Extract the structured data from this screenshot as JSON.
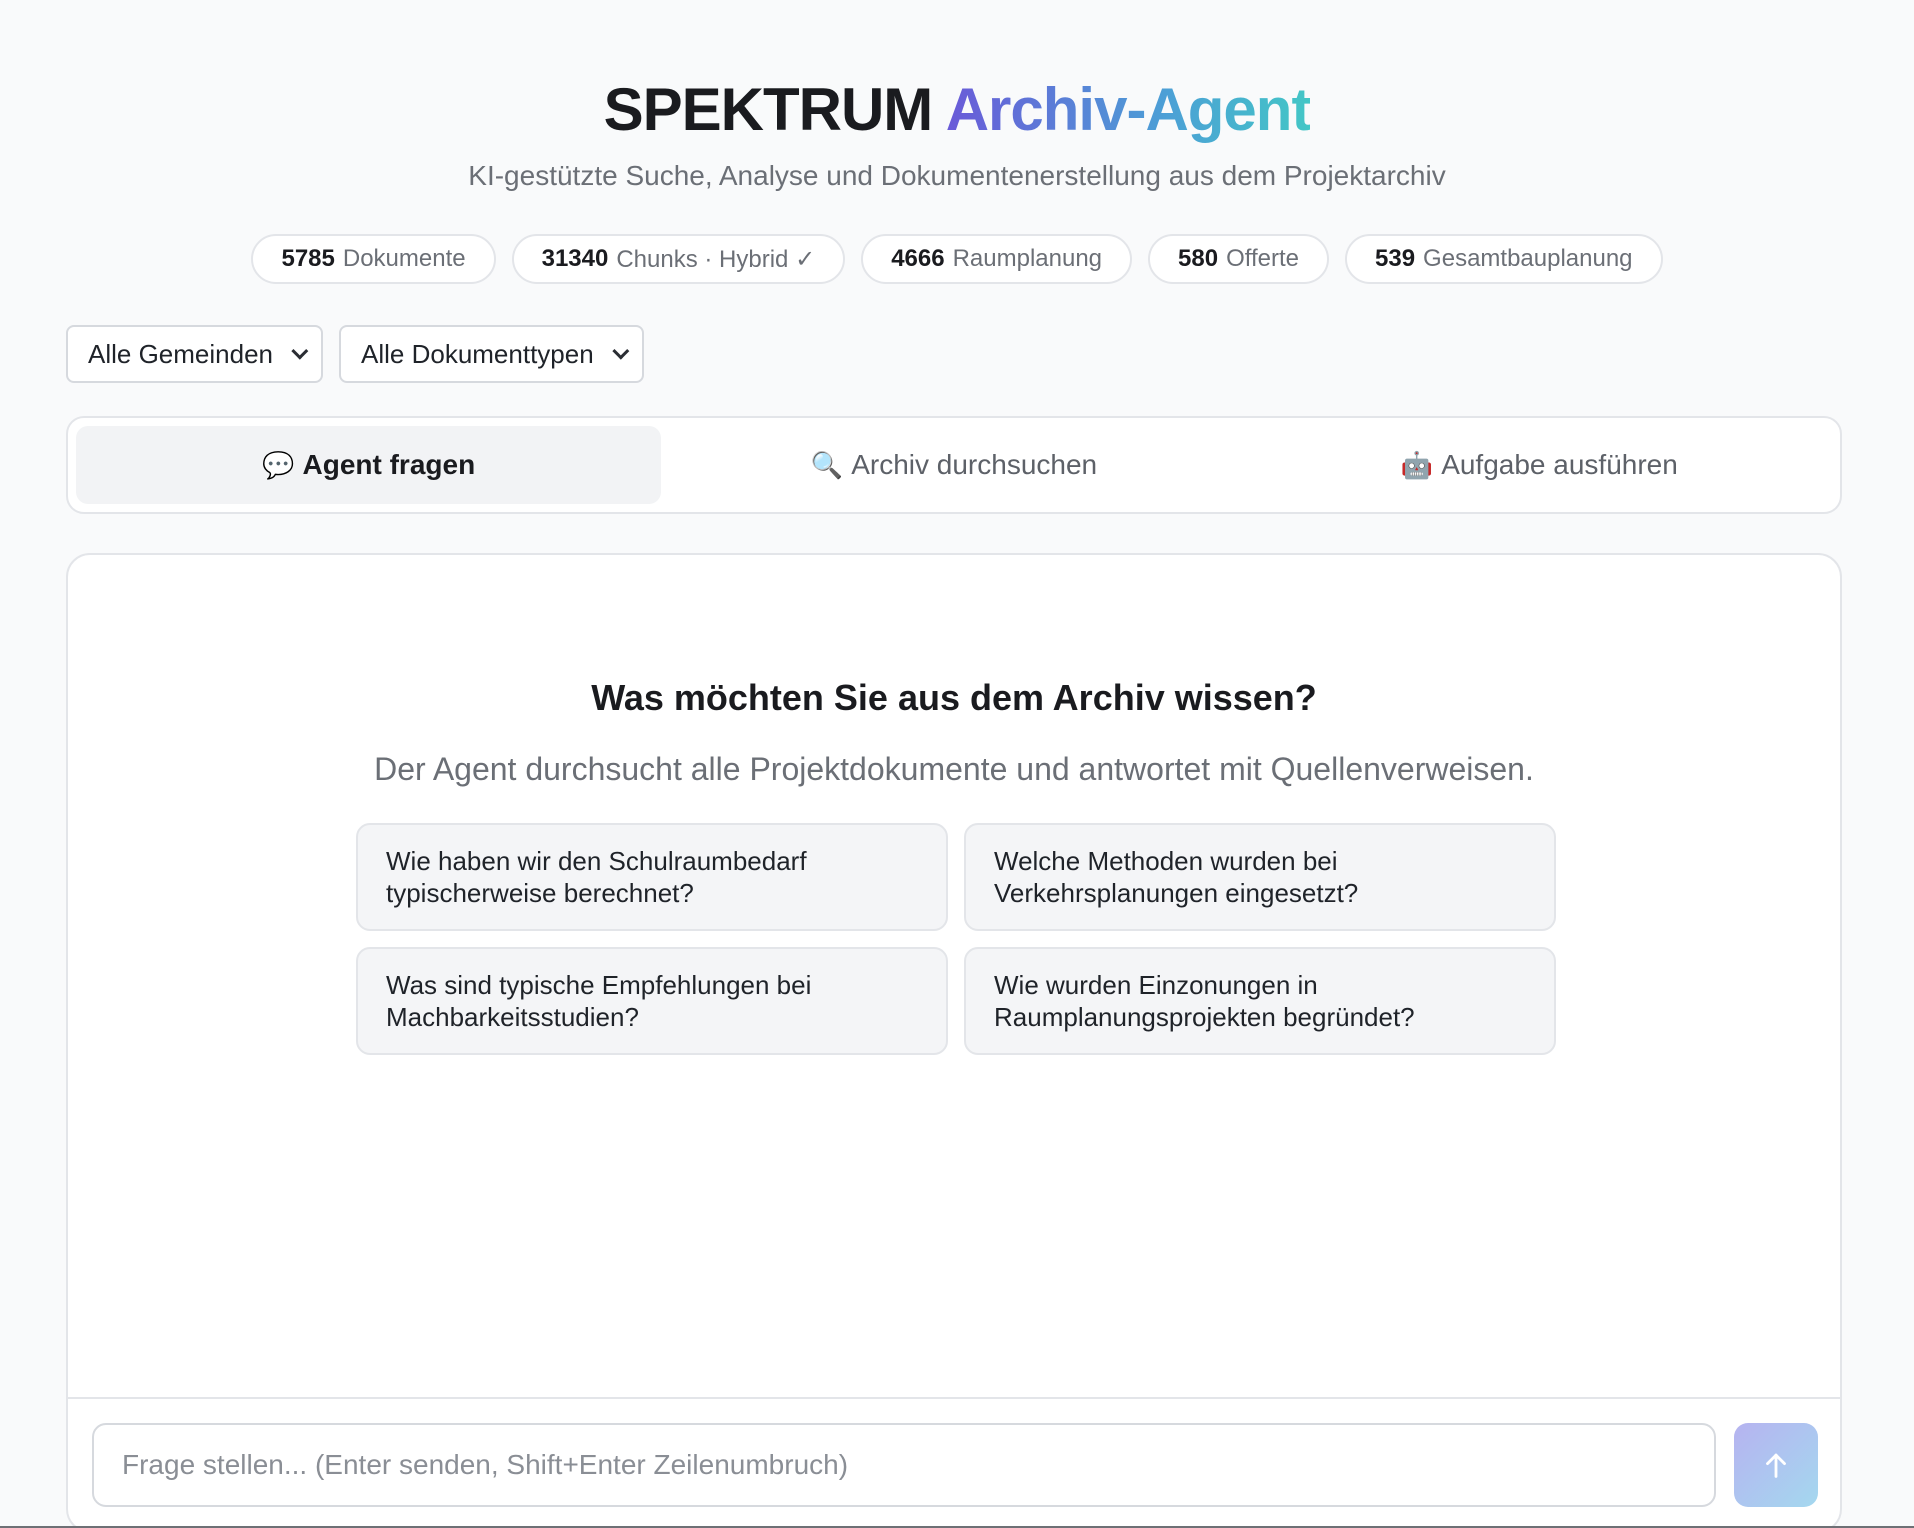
{
  "header": {
    "title_brand": "SPEKTRUM",
    "title_accent": "Archiv-Agent",
    "subtitle": "KI-gestützte Suche, Analyse und Dokumentenerstellung aus dem Projektarchiv"
  },
  "stats": [
    {
      "count": "5785",
      "label": "Dokumente"
    },
    {
      "count": "31340",
      "label": "Chunks · Hybrid ✓"
    },
    {
      "count": "4666",
      "label": "Raumplanung"
    },
    {
      "count": "580",
      "label": "Offerte"
    },
    {
      "count": "539",
      "label": "Gesamtbauplanung"
    }
  ],
  "filters": {
    "gemeinde": "Alle Gemeinden",
    "dokumenttyp": "Alle Dokumenttypen"
  },
  "tabs": [
    {
      "icon": "💬",
      "label": "Agent fragen"
    },
    {
      "icon": "🔍",
      "label": "Archiv durchsuchen"
    },
    {
      "icon": "🤖",
      "label": "Aufgabe ausführen"
    }
  ],
  "chat": {
    "welcome_title": "Was möchten Sie aus dem Archiv wissen?",
    "welcome_subtitle": "Der Agent durchsucht alle Projektdokumente und antwortet mit Quellenverweisen.",
    "suggestions": [
      "Wie haben wir den Schulraumbedarf typischerweise berechnet?",
      "Welche Methoden wurden bei Verkehrsplanungen eingesetzt?",
      "Was sind typische Empfehlungen bei Machbarkeitsstudien?",
      "Wie wurden Einzonungen in Raumplanungsprojekten begründet?"
    ],
    "input_placeholder": "Frage stellen... (Enter senden, Shift+Enter Zeilenumbruch)",
    "input_value": ""
  },
  "colors": {
    "accent_start": "#6a5ad8",
    "accent_end": "#43c6c6",
    "send_button": "#b6b3f0"
  }
}
